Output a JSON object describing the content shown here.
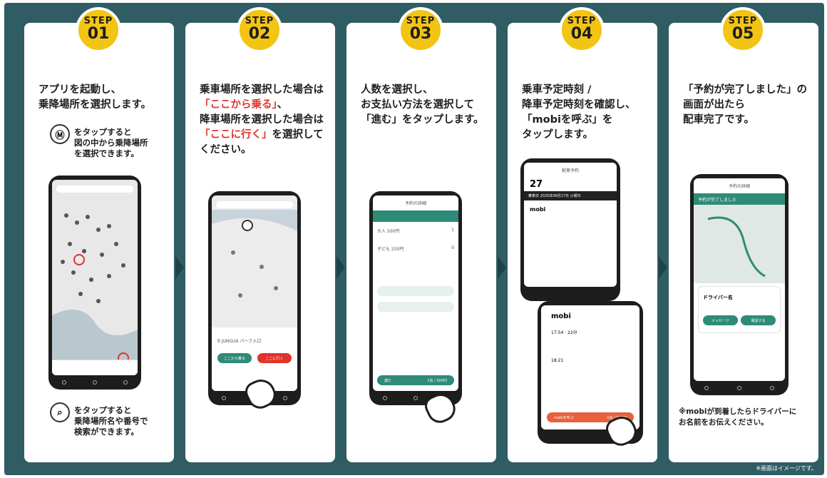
{
  "steps": [
    {
      "label": "STEP",
      "num": "01",
      "title": [
        "アプリを起動し、",
        "乗降場所を選択します。"
      ]
    },
    {
      "label": "STEP",
      "num": "02",
      "title_a": "乗車場所を選択した場合は",
      "title_b": "「ここから乗る」",
      "title_c": "、",
      "title_d": "降車場所を選択した場合は",
      "title_e": "「ここに行く」",
      "title_f": "を選択して",
      "title_g": "ください。"
    },
    {
      "label": "STEP",
      "num": "03",
      "title": [
        "人数を選択し、",
        "お支払い方法を選択して",
        "「進む」をタップします。"
      ]
    },
    {
      "label": "STEP",
      "num": "04",
      "title": [
        "乗車予定時刻 /",
        "降車予定時刻を確認し、",
        "「mobiを呼ぶ」を",
        "タップします。"
      ]
    },
    {
      "label": "STEP",
      "num": "05",
      "title": [
        "「予約が完了しました」の",
        "画面が出たら",
        "配車完了です。"
      ]
    }
  ],
  "step1": {
    "pin_note": [
      "をタップすると",
      "図の中から乗降場所",
      "を選択できます。"
    ],
    "search_note": [
      "をタップすると",
      "乗降場所名や番号で",
      "検索ができます。"
    ],
    "pin_icon": "pin-m-icon",
    "search_icon": "search-icon"
  },
  "step2": {
    "place": "ß JUNGUA パーク入口",
    "btn_ride": "ここから乗る",
    "btn_go": "ここに行く"
  },
  "step3": {
    "header": "予約の詳細",
    "row1": "大人 500円",
    "row1_val": "1",
    "row2": "子ども 250円",
    "row2_val": "0",
    "go": "進む",
    "total": "1名 / 500円"
  },
  "step4": {
    "header": "配車予約",
    "big": "27",
    "date": "乗車日 2025年06月17日 火曜日",
    "mobi": "mobi",
    "t1": "17:54",
    "t2": "18:21",
    "dur": "22分",
    "call": "mobiを呼ぶ",
    "price": "1名 / 500円"
  },
  "step5": {
    "header": "予約の詳細",
    "done": "予約が完了しました",
    "driver": "ドライバー名",
    "msg": "メッセージ",
    "tel": "電話する"
  },
  "step5_note": [
    "※mobiが到着したらドライバーに",
    "お名前をお伝えください。"
  ],
  "footer": "※画面はイメージです。"
}
